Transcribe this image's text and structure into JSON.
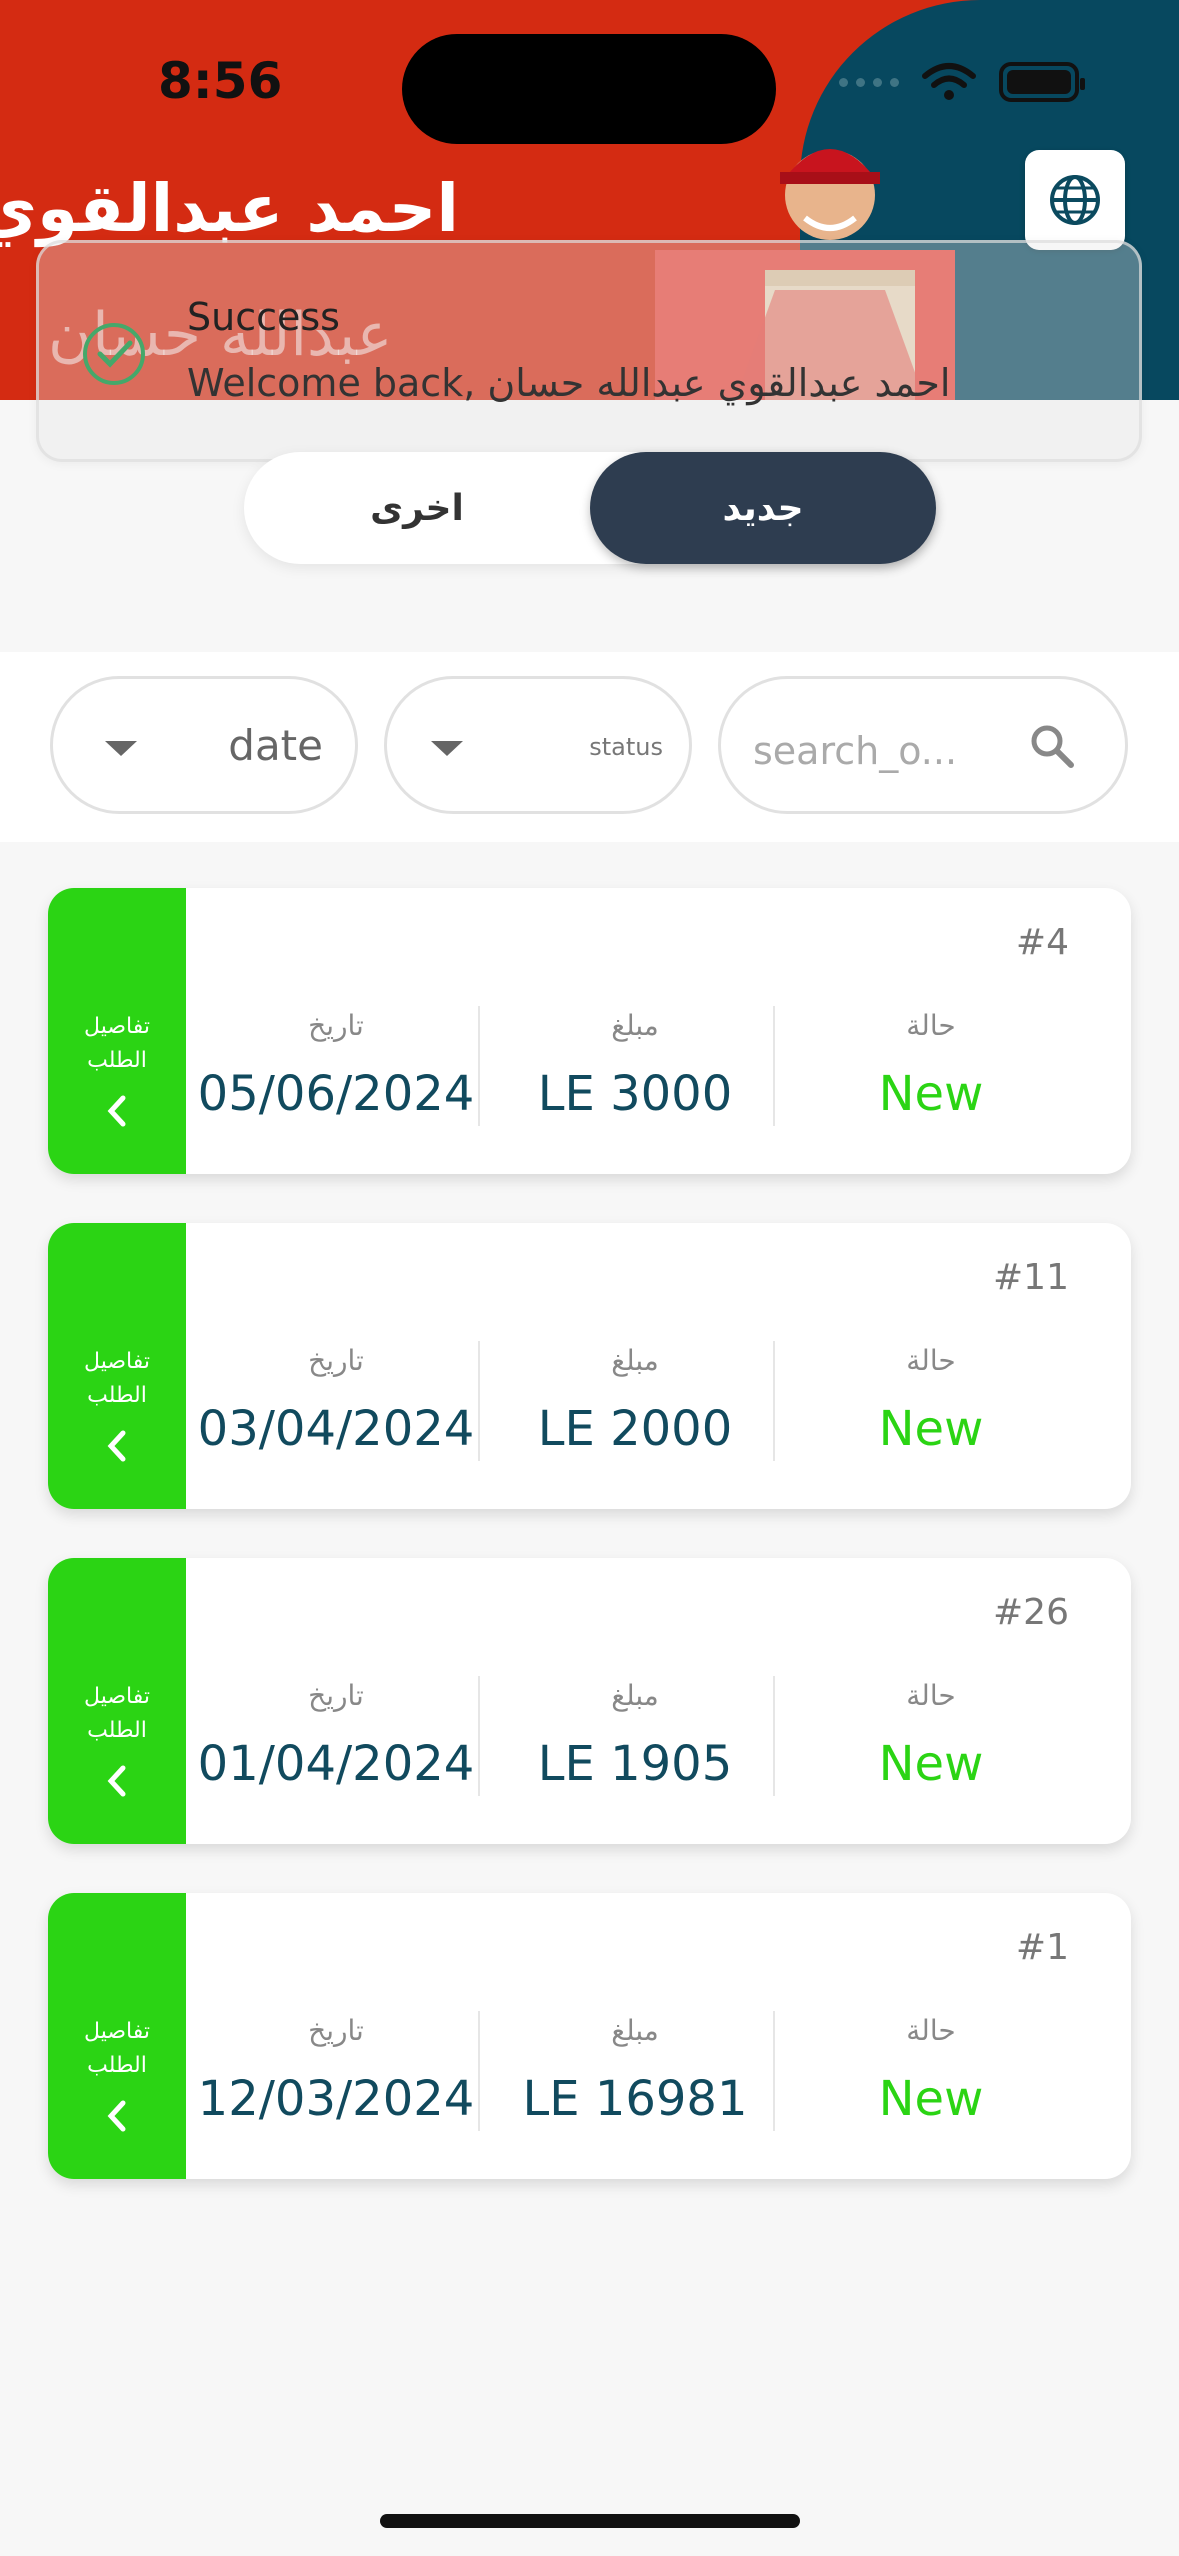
{
  "status_bar": {
    "time": "8:56"
  },
  "header": {
    "user_name": "احمد عبدالقوي",
    "user_name_second": "عبدالله حسان"
  },
  "toast": {
    "title": "Success",
    "message": "Welcome back, احمد عبدالقوي عبدالله حسان"
  },
  "tabs": {
    "new_label": "جديد",
    "other_label": "اخرى"
  },
  "filters": {
    "date_label": "date",
    "status_label": "status",
    "search_placeholder": "search_o..."
  },
  "labels": {
    "details": "تفاصيل الطلب",
    "date": "تاريخ",
    "amount": "مبلغ",
    "status": "حالة"
  },
  "orders": [
    {
      "id": "#4",
      "date": "05/06/2024",
      "amount": "LE 3000",
      "status": "New"
    },
    {
      "id": "#11",
      "date": "03/04/2024",
      "amount": "LE 2000",
      "status": "New"
    },
    {
      "id": "#26",
      "date": "01/04/2024",
      "amount": "LE 1905",
      "status": "New"
    },
    {
      "id": "#1",
      "date": "12/03/2024",
      "amount": "LE 16981",
      "status": "New"
    }
  ],
  "colors": {
    "header_red": "#d42b12",
    "header_teal": "#07485f",
    "accent_green": "#2bd414",
    "tab_dark": "#2e3d50",
    "value_teal": "#114a5e"
  }
}
